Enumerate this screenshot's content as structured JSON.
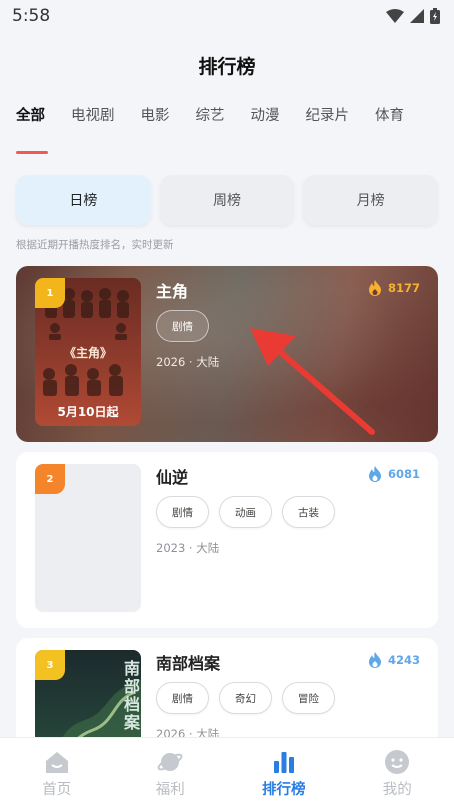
{
  "status": {
    "time": "5:58"
  },
  "header": {
    "title": "排行榜"
  },
  "categories": [
    "全部",
    "电视剧",
    "电影",
    "综艺",
    "动漫",
    "纪录片",
    "体育"
  ],
  "periods": [
    "日榜",
    "周榜",
    "月榜"
  ],
  "hint": "根据近期开播热度排名，实时更新",
  "items": [
    {
      "rank": "1",
      "title": "主角",
      "heat": "8177",
      "tags": [
        "剧情"
      ],
      "meta": "2026 · 大陆",
      "poster_title": "《主角》",
      "poster_date": "5月10日起"
    },
    {
      "rank": "2",
      "title": "仙逆",
      "heat": "6081",
      "tags": [
        "剧情",
        "动画",
        "古装"
      ],
      "meta": "2023 · 大陆"
    },
    {
      "rank": "3",
      "title": "南部档案",
      "heat": "4243",
      "tags": [
        "剧情",
        "奇幻",
        "冒险"
      ],
      "meta": "2026 · 大陆",
      "poster_title": "南部档案"
    }
  ],
  "nav": [
    "首页",
    "福利",
    "排行榜",
    "我的"
  ],
  "colors": {
    "accent": "#2a7de1",
    "underline": "#ef5b54",
    "heat_top": "#f8b12f",
    "heat": "#5ea7e8",
    "arrow": "#ea3a34"
  }
}
